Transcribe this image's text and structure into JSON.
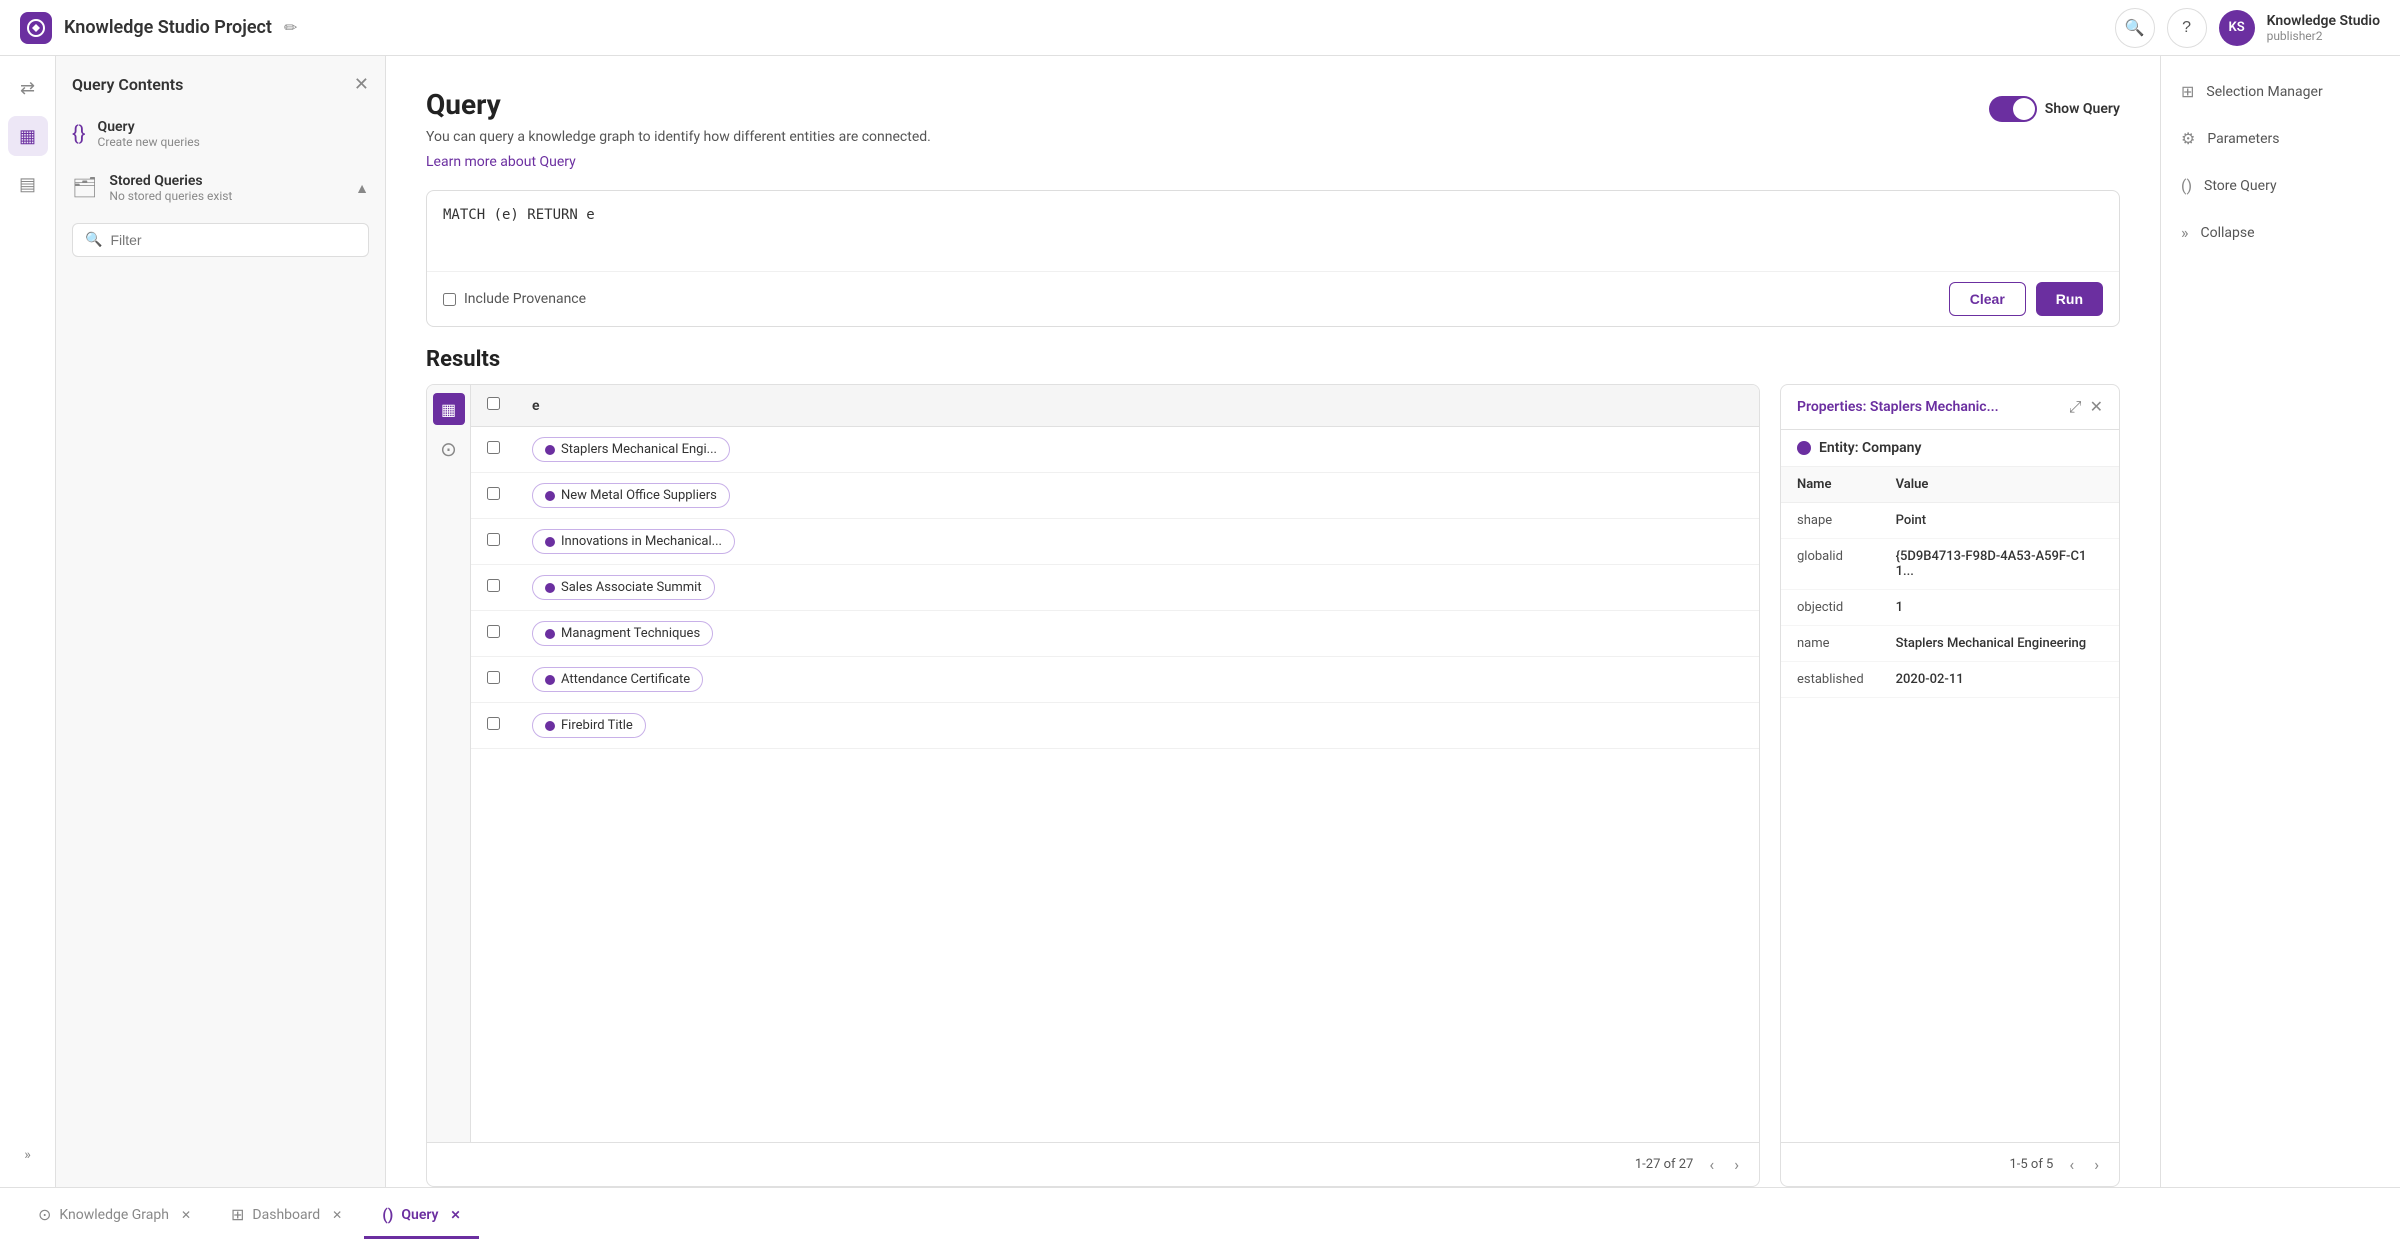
{
  "app": {
    "title": "Knowledge Studio Project",
    "user": {
      "initials": "KS",
      "name": "Knowledge Studio",
      "role": "publisher2"
    }
  },
  "left_panel": {
    "title": "Query Contents",
    "query_item": {
      "label": "Query",
      "sub": "Create new queries"
    },
    "stored_queries": {
      "label": "Stored Queries",
      "sub": "No stored queries exist",
      "chevron": "▲"
    },
    "filter_placeholder": "Filter"
  },
  "query": {
    "title": "Query",
    "description": "You can query a knowledge graph to identify how different entities are connected.",
    "link_text": "Learn more about Query",
    "show_query_label": "Show Query",
    "editor_content": "MATCH (e) RETURN e",
    "provenance_label": "Include Provenance",
    "clear_label": "Clear",
    "run_label": "Run"
  },
  "results": {
    "title": "Results",
    "column_header": "e",
    "pagination": "1-27 of 27",
    "rows": [
      {
        "id": 1,
        "label": "Staplers Mechanical Engi..."
      },
      {
        "id": 2,
        "label": "New Metal Office Suppliers"
      },
      {
        "id": 3,
        "label": "Innovations in Mechanical..."
      },
      {
        "id": 4,
        "label": "Sales Associate Summit"
      },
      {
        "id": 5,
        "label": "Managment Techniques"
      },
      {
        "id": 6,
        "label": "Attendance Certificate"
      },
      {
        "id": 7,
        "label": "Firebird Title"
      }
    ]
  },
  "properties": {
    "title": "Properties: ",
    "title_value": "Staplers Mechanic...",
    "entity_label": "Entity: ",
    "entity_value": "Company",
    "pagination": "1-5 of 5",
    "rows": [
      {
        "name": "shape",
        "value": "Point"
      },
      {
        "name": "globalid",
        "value": "{5D9B4713-F98D-4A53-A59F-C11..."
      },
      {
        "name": "objectid",
        "value": "1"
      },
      {
        "name": "name",
        "value": "Staplers Mechanical Engineering"
      },
      {
        "name": "established",
        "value": "2020-02-11"
      }
    ]
  },
  "right_menu": {
    "items": [
      {
        "id": "selection-manager",
        "icon": "⊞",
        "label": "Selection Manager"
      },
      {
        "id": "parameters",
        "icon": "⚙",
        "label": "Parameters"
      },
      {
        "id": "store-query",
        "icon": "()",
        "label": "Store Query"
      },
      {
        "id": "collapse",
        "icon": "»",
        "label": "Collapse"
      }
    ]
  },
  "bottom_tabs": [
    {
      "id": "knowledge-graph",
      "icon": "⊙",
      "label": "Knowledge Graph",
      "active": false
    },
    {
      "id": "dashboard",
      "icon": "⊞",
      "label": "Dashboard",
      "active": false
    },
    {
      "id": "query",
      "icon": "()",
      "label": "Query",
      "active": true
    }
  ]
}
